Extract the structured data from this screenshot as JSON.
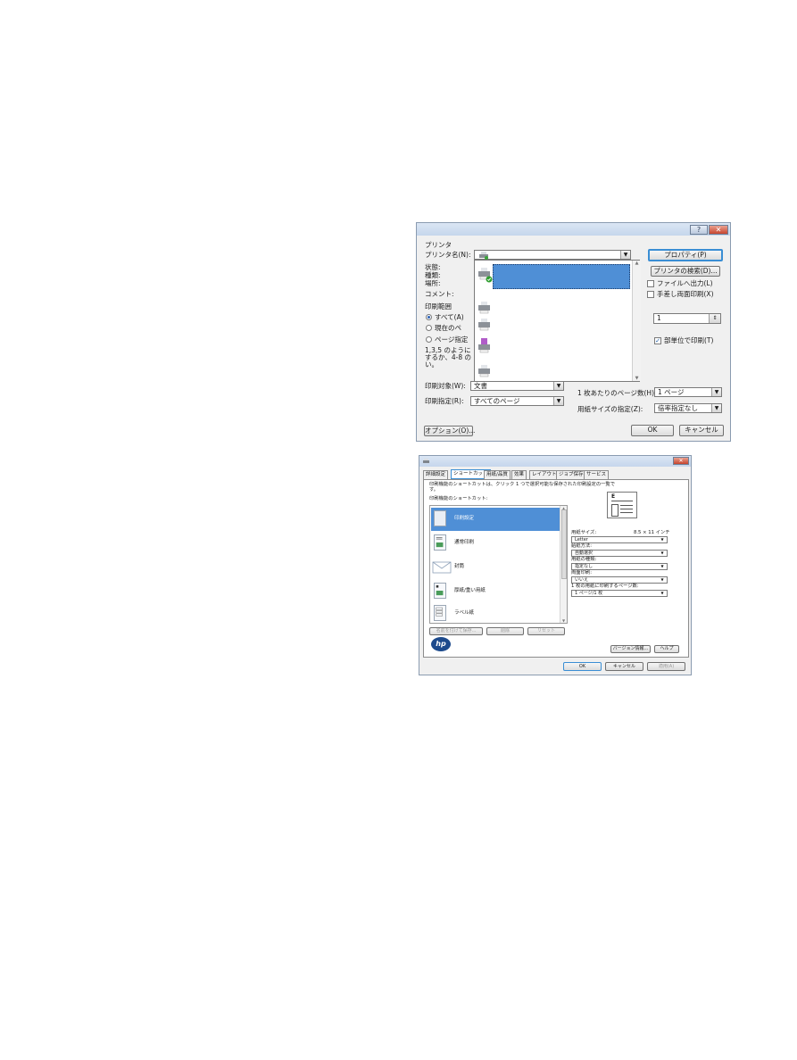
{
  "print_dialog": {
    "printer_group": "プリンタ",
    "printer_name_label": "プリンタ名(N):",
    "status_label": "状態:",
    "type_label": "種類:",
    "location_label": "場所:",
    "comment_label": "コメント:",
    "properties_button": "プロパティ(P)",
    "find_printer_button": "プリンタの検索(D)...",
    "print_to_file": "ファイルへ出力(L)",
    "manual_duplex": "手差し両面印刷(X)",
    "range_group": "印刷範囲",
    "range_all": "すべて(A)",
    "range_current": "現在のペ",
    "range_pages": "ページ指定",
    "range_help": [
      "1,3,5 のように",
      "するか、4-8 の",
      "い。"
    ],
    "copies_value": "1",
    "collate": "部単位で印刷(T)",
    "print_what_label": "印刷対象(W):",
    "print_what_value": "文書",
    "print_label": "印刷指定(R):",
    "print_value": "すべてのページ",
    "pages_per_sheet_label": "1 枚あたりのページ数(H):",
    "pages_per_sheet_value": "1 ページ",
    "scale_label": "用紙サイズの指定(Z):",
    "scale_value": "倍率指定なし",
    "options_button": "オプション(O)...",
    "ok_button": "OK",
    "cancel_button": "キャンセル",
    "help_glyph": "?",
    "close_glyph": "✕"
  },
  "props_dialog": {
    "tabs": [
      "詳細設定",
      "ショートカット",
      "用紙/品質",
      "効果",
      "レイアウト",
      "ジョブ保存",
      "サービス"
    ],
    "description": "印刷機能のショートカットは、クリック 1 つで選択可能な保存された印刷設定の一覧で",
    "description2": "す。",
    "list_label": "印刷機能のショートカット:",
    "shortcuts": [
      {
        "label": "印刷設定"
      },
      {
        "label": "通常印刷"
      },
      {
        "label": "封筒"
      },
      {
        "label": "厚紙/重い用紙"
      },
      {
        "label": "ラベル紙"
      }
    ],
    "paper_size_label": "用紙サイズ:",
    "paper_size_dims": "8.5 × 11 インチ",
    "paper_size_value": "Letter",
    "source_label": "給紙方法:",
    "source_value": "自動選択",
    "type_label": "用紙の種類:",
    "type_value": "指定なし",
    "duplex_label": "両面印刷:",
    "duplex_value": "いいえ",
    "pps_label": "1 枚の用紙に印刷するページ数:",
    "pps_value": "1 ページ/1 枚",
    "save_as_button": "名前を付けて保存...",
    "delete_button": "削除",
    "reset_button": "リセット",
    "about_button": "バージョン情報...",
    "help_button": "ヘルプ",
    "ok_button": "OK",
    "cancel_button": "キャンセル",
    "apply_button": "適用(A)",
    "preview_letter": "E",
    "logo_text": "hp",
    "close_glyph": "✕"
  },
  "colors": {
    "selection": "#4f8fd6",
    "focus": "#3a8ed4",
    "close": "#c7452e"
  }
}
